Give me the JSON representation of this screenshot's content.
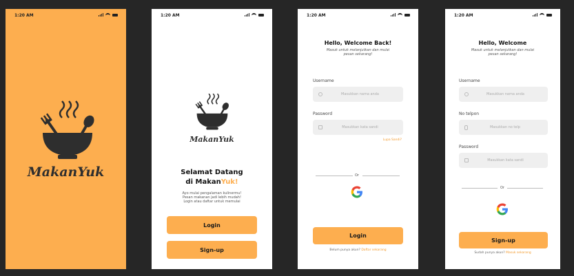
{
  "status_time": "1:20 AM",
  "splash": {
    "brand": "MakanYuk"
  },
  "welcome": {
    "brand": "MakanYuk",
    "title_line1": "Selamat Datang",
    "title_line2_pre": "di Makan",
    "title_line2_accent": "Yuk!",
    "description_lines": [
      "Ayo mulai pengalaman kulinermu!",
      "Pesan makanan jadi lebih mudah!",
      "Login atau daftar untuk memulai"
    ],
    "login_button": "Login",
    "signup_button": "Sign-up"
  },
  "login": {
    "title": "Hello, Welcome Back!",
    "subtitle_lines": [
      "Masuk untuk melanjutkan dan mulai",
      "pesan sekarang!"
    ],
    "username_label": "Username",
    "username_placeholder": "Masukkan nama anda",
    "password_label": "Password",
    "password_placeholder": "Masukkan kata sandi",
    "forgot_link": "Lupa Sandi?",
    "or_text": "Or",
    "login_button": "Login",
    "footer_text": "Belum punya akun?",
    "footer_link": "Daftar sekarang"
  },
  "signup": {
    "title": "Hello, Welcome",
    "subtitle_lines": [
      "Masuk untuk melanjutkan dan mulai",
      "pesan sekarang!"
    ],
    "username_label": "Username",
    "username_placeholder": "Masukkan nama anda",
    "phone_label": "No telpon",
    "phone_placeholder": "Masukkan no telp",
    "password_label": "Password",
    "password_placeholder": "Masukkan kata sandi",
    "or_text": "Or",
    "signup_button": "Sign-up",
    "footer_text": "Sudah punya akun?",
    "footer_link": "Masuk sekarang"
  },
  "colors": {
    "accent": "#FDAE4F",
    "background": "#262626",
    "dark": "#2e2e2e"
  },
  "icons": [
    "bowl-logo-icon",
    "user-icon",
    "lock-icon",
    "phone-icon",
    "google-icon",
    "signal-icon",
    "wifi-icon",
    "battery-icon"
  ]
}
